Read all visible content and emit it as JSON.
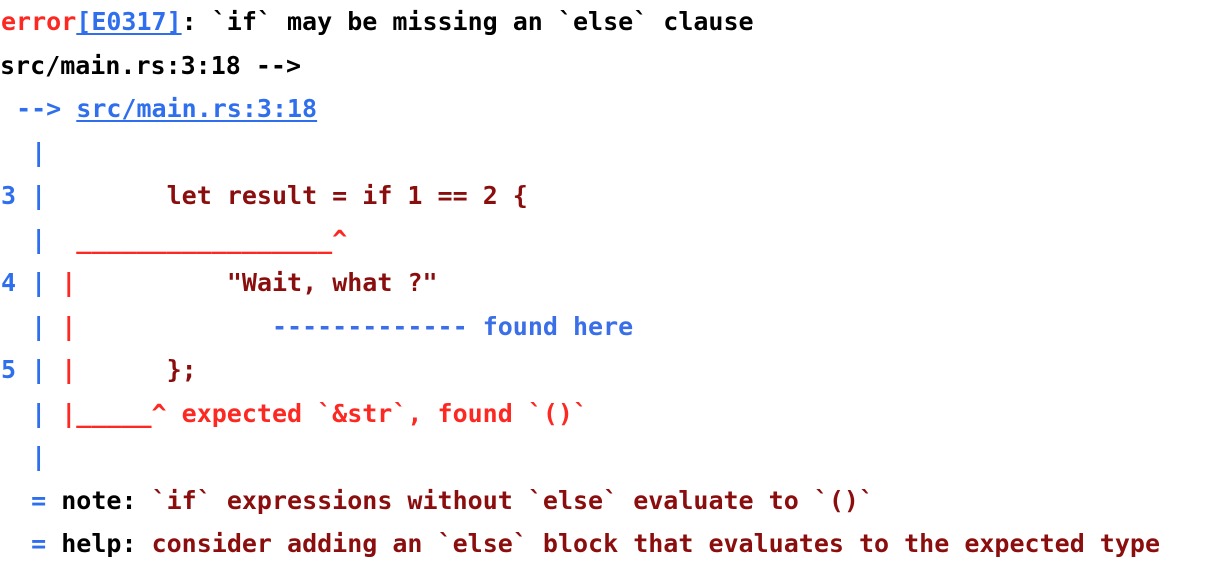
{
  "meta": {
    "app": "rustc-compiler-diagnostic",
    "colors": {
      "error_red": "#fc2822",
      "link_blue": "#2f6fed",
      "gutter_blue": "#3b6fe8",
      "code_maroon": "#8b0e0e",
      "text_black": "#000000",
      "background": "#ffffff"
    }
  },
  "diagnostic": {
    "header": {
      "severity": "error",
      "code": "[E0317]",
      "separator": ": ",
      "message": "`if` may be missing an `else` clause"
    },
    "location": {
      "arrow": "-->",
      "path": "src/main.rs:3:18"
    },
    "gutter": {
      "pipe": "|",
      "blank_lineno": "  "
    },
    "snippet": [
      {
        "lineno": "3",
        "pipe": "|",
        "span_marker": "",
        "code": "    let result = if 1 == 2 {"
      },
      {
        "lineno": "4",
        "pipe": "|",
        "span_marker": "|",
        "code": "      \"Wait, what ?\""
      },
      {
        "lineno": "5",
        "pipe": "|",
        "span_marker": "|",
        "code": "  };"
      }
    ],
    "annotations": {
      "caret_underline": "  _________________^",
      "found_here_dashes": "             -------------",
      "found_here_label": "found here",
      "close_span": "|_____^ expected `&str`, found `()`"
    },
    "footnotes": [
      {
        "bullet": "=",
        "label": "note:",
        "text": "`if` expressions without `else` evaluate to `()`"
      },
      {
        "bullet": "=",
        "label": "help:",
        "text": "consider adding an `else` block that evaluates to the expected type"
      }
    ]
  }
}
